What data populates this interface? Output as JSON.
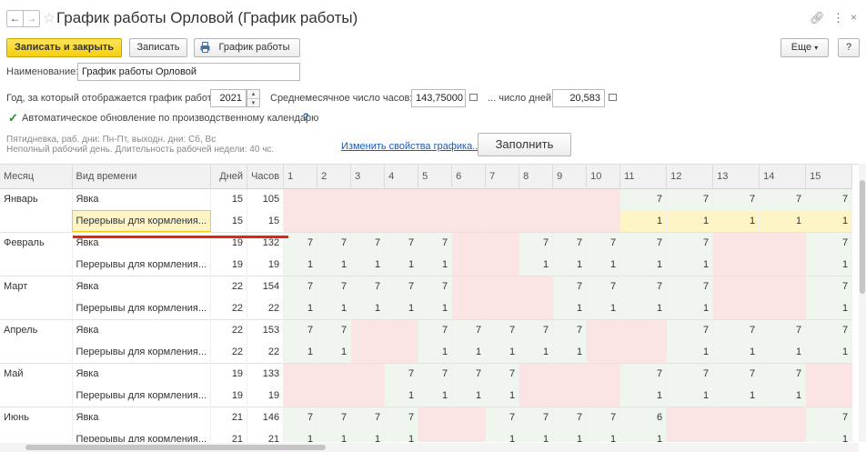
{
  "window": {
    "title": "График работы Орловой (График работы)",
    "more_label": "Еще",
    "help_label": "?"
  },
  "toolbar": {
    "save_close": "Записать и закрыть",
    "save": "Записать",
    "schedule": "График работы"
  },
  "form": {
    "name_label": "Наименование:",
    "name_value": "График работы Орловой",
    "year_label": "Год, за который отображается график работы:",
    "year_value": "2021",
    "avg_hours_label": "Среднемесячное число часов:",
    "avg_hours_value": "143,75000",
    "days_label": "... число дней:",
    "days_value": "20,583",
    "auto_update_checked": true,
    "auto_update_label": "Автоматическое обновление по производственному календарю",
    "help_mark": "?",
    "info_line1": "Пятидневка, раб. дни: Пн-Пт, выходн. дни: Сб, Вс",
    "info_line2": "Неполный рабочий день. Длительность рабочей недели: 40 чс.",
    "change_props_link": "Изменить свойства графика...",
    "fill_button": "Заполнить"
  },
  "colors": {
    "accent": "#f5cf0f",
    "weekend": "#fbe4e4",
    "workday": "#eef6ee",
    "selected": "#fff4c5",
    "underline": "#e0241b"
  },
  "table": {
    "columns": [
      "Месяц",
      "Вид времени",
      "Дней",
      "Часов",
      "1",
      "2",
      "3",
      "4",
      "5",
      "6",
      "7",
      "8",
      "9",
      "10",
      "11",
      "12",
      "13",
      "14",
      "15"
    ],
    "rows": [
      {
        "month": "Январь",
        "type": "Явка",
        "days": "15",
        "hours": "105",
        "cells": [
          "",
          "",
          "",
          "",
          "",
          "",
          "",
          "",
          "",
          "",
          "7",
          "7",
          "7",
          "7",
          "7"
        ],
        "weekend": [
          1,
          1,
          1,
          1,
          1,
          1,
          1,
          1,
          1,
          1,
          0,
          0,
          0,
          0,
          0
        ]
      },
      {
        "month": "",
        "type": "Перерывы для кормления...",
        "days": "15",
        "hours": "15",
        "cells": [
          "",
          "",
          "",
          "",
          "",
          "",
          "",
          "",
          "",
          "",
          "1",
          "1",
          "1",
          "1",
          "1"
        ],
        "weekend": [
          1,
          1,
          1,
          1,
          1,
          1,
          1,
          1,
          1,
          1,
          0,
          0,
          0,
          0,
          0
        ],
        "selected": true
      },
      {
        "month": "Февраль",
        "type": "Явка",
        "days": "19",
        "hours": "132",
        "cells": [
          "7",
          "7",
          "7",
          "7",
          "7",
          "",
          "",
          "7",
          "7",
          "7",
          "7",
          "7",
          "",
          "",
          "7"
        ],
        "weekend": [
          0,
          0,
          0,
          0,
          0,
          1,
          1,
          0,
          0,
          0,
          0,
          0,
          1,
          1,
          0
        ]
      },
      {
        "month": "",
        "type": "Перерывы для кормления...",
        "days": "19",
        "hours": "19",
        "cells": [
          "1",
          "1",
          "1",
          "1",
          "1",
          "",
          "",
          "1",
          "1",
          "1",
          "1",
          "1",
          "",
          "",
          "1"
        ],
        "weekend": [
          0,
          0,
          0,
          0,
          0,
          1,
          1,
          0,
          0,
          0,
          0,
          0,
          1,
          1,
          0
        ]
      },
      {
        "month": "Март",
        "type": "Явка",
        "days": "22",
        "hours": "154",
        "cells": [
          "7",
          "7",
          "7",
          "7",
          "7",
          "",
          "",
          "",
          "7",
          "7",
          "7",
          "7",
          "",
          "",
          "7"
        ],
        "weekend": [
          0,
          0,
          0,
          0,
          0,
          1,
          1,
          1,
          0,
          0,
          0,
          0,
          1,
          1,
          0
        ]
      },
      {
        "month": "",
        "type": "Перерывы для кормления...",
        "days": "22",
        "hours": "22",
        "cells": [
          "1",
          "1",
          "1",
          "1",
          "1",
          "",
          "",
          "",
          "1",
          "1",
          "1",
          "1",
          "",
          "",
          "1"
        ],
        "weekend": [
          0,
          0,
          0,
          0,
          0,
          1,
          1,
          1,
          0,
          0,
          0,
          0,
          1,
          1,
          0
        ]
      },
      {
        "month": "Апрель",
        "type": "Явка",
        "days": "22",
        "hours": "153",
        "cells": [
          "7",
          "7",
          "",
          "",
          "7",
          "7",
          "7",
          "7",
          "7",
          "",
          "",
          "7",
          "7",
          "7",
          "7"
        ],
        "weekend": [
          0,
          0,
          1,
          1,
          0,
          0,
          0,
          0,
          0,
          1,
          1,
          0,
          0,
          0,
          0
        ]
      },
      {
        "month": "",
        "type": "Перерывы для кормления...",
        "days": "22",
        "hours": "22",
        "cells": [
          "1",
          "1",
          "",
          "",
          "1",
          "1",
          "1",
          "1",
          "1",
          "",
          "",
          "1",
          "1",
          "1",
          "1"
        ],
        "weekend": [
          0,
          0,
          1,
          1,
          0,
          0,
          0,
          0,
          0,
          1,
          1,
          0,
          0,
          0,
          0
        ]
      },
      {
        "month": "Май",
        "type": "Явка",
        "days": "19",
        "hours": "133",
        "cells": [
          "",
          "",
          "",
          "7",
          "7",
          "7",
          "7",
          "",
          "",
          "",
          "7",
          "7",
          "7",
          "7",
          ""
        ],
        "weekend": [
          1,
          1,
          1,
          0,
          0,
          0,
          0,
          1,
          1,
          1,
          0,
          0,
          0,
          0,
          1
        ]
      },
      {
        "month": "",
        "type": "Перерывы для кормления...",
        "days": "19",
        "hours": "19",
        "cells": [
          "",
          "",
          "",
          "1",
          "1",
          "1",
          "1",
          "",
          "",
          "",
          "1",
          "1",
          "1",
          "1",
          ""
        ],
        "weekend": [
          1,
          1,
          1,
          0,
          0,
          0,
          0,
          1,
          1,
          1,
          0,
          0,
          0,
          0,
          1
        ]
      },
      {
        "month": "Июнь",
        "type": "Явка",
        "days": "21",
        "hours": "146",
        "cells": [
          "7",
          "7",
          "7",
          "7",
          "",
          "",
          "7",
          "7",
          "7",
          "7",
          "6",
          "",
          "",
          "",
          "7"
        ],
        "weekend": [
          0,
          0,
          0,
          0,
          1,
          1,
          0,
          0,
          0,
          0,
          0,
          1,
          1,
          1,
          0
        ]
      },
      {
        "month": "",
        "type": "Перерывы для кормления...",
        "days": "21",
        "hours": "21",
        "cells": [
          "1",
          "1",
          "1",
          "1",
          "",
          "",
          "1",
          "1",
          "1",
          "1",
          "1",
          "",
          "",
          "",
          "1"
        ],
        "weekend": [
          0,
          0,
          0,
          0,
          1,
          1,
          0,
          0,
          0,
          0,
          0,
          1,
          1,
          1,
          0
        ]
      }
    ]
  }
}
